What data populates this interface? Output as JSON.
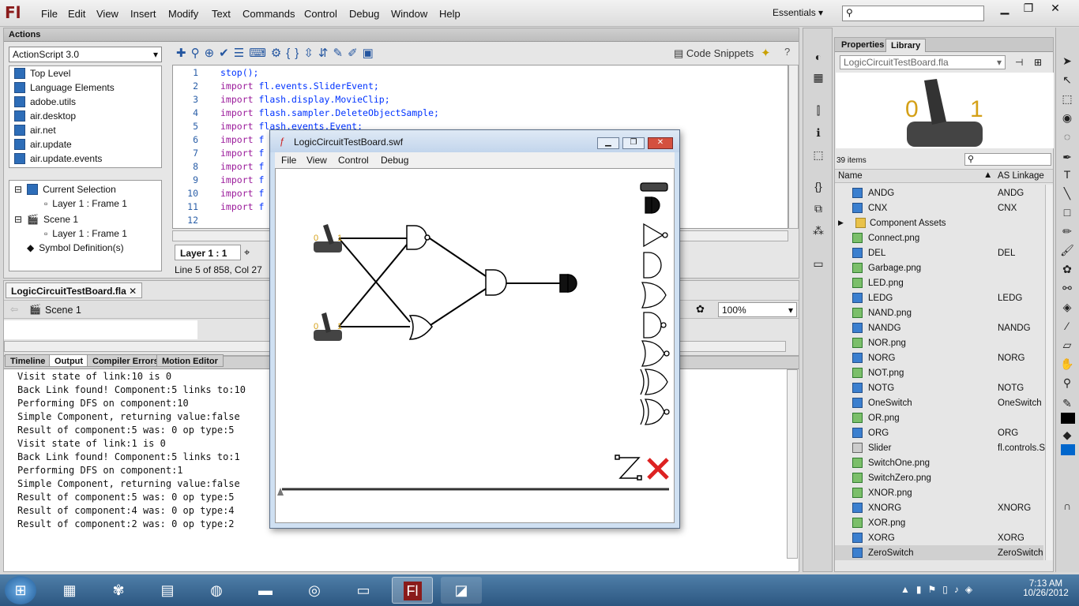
{
  "menu": {
    "items": [
      "File",
      "Edit",
      "View",
      "Insert",
      "Modify",
      "Text",
      "Commands",
      "Control",
      "Debug",
      "Window",
      "Help"
    ],
    "workspace": "Essentials",
    "logo": "Fl"
  },
  "actions": {
    "title": "Actions",
    "language": "ActionScript 3.0",
    "toolbox": [
      "Top Level",
      "Language Elements",
      "adobe.utils",
      "air.desktop",
      "air.net",
      "air.update",
      "air.update.events"
    ],
    "tree": {
      "current_selection": "Current Selection",
      "layer_frame": "Layer 1 : Frame 1",
      "scene": "Scene 1",
      "layer_frame2": "Layer 1 : Frame 1",
      "symbol_defs": "Symbol Definition(s)"
    },
    "code_snippets": "Code Snippets",
    "line_numbers": [
      "1",
      "2",
      "3",
      "4",
      "5",
      "6",
      "7",
      "8",
      "9",
      "10",
      "11",
      "12"
    ],
    "code_lines": [
      [
        "stop();",
        ""
      ],
      [
        "import ",
        "fl.events.SliderEvent;"
      ],
      [
        "import ",
        "flash.display.MovieClip;"
      ],
      [
        "import ",
        "flash.sampler.DeleteObjectSample;"
      ],
      [
        "import ",
        "flash.events.Event;"
      ],
      [
        "import ",
        "f"
      ],
      [
        "import ",
        "f"
      ],
      [
        "import ",
        "f"
      ],
      [
        "import ",
        "f"
      ],
      [
        "import ",
        "f"
      ],
      [
        "import ",
        "f"
      ],
      [
        "",
        ""
      ]
    ],
    "layer_tab": "Layer 1 : 1",
    "status": "Line 5 of 858, Col 27"
  },
  "document": {
    "tab": "LogicCircuitTestBoard.fla",
    "scene": "Scene 1",
    "zoom": "100%"
  },
  "output": {
    "tabs": [
      "Timeline",
      "Output",
      "Compiler Errors",
      "Motion Editor"
    ],
    "lines": [
      "Visit state of link:10 is 0",
      "Back Link found! Component:5 links to:10",
      "Performing DFS on component:10",
      "Simple Component, returning value:false",
      "Result of component:5 was: 0 op type:5",
      "Visit state of link:1 is 0",
      "Back Link found! Component:5 links to:1",
      "Performing DFS on component:1",
      "Simple Component, returning value:false",
      "Result of component:5 was: 0 op type:5",
      "Result of component:4 was: 0 op type:4",
      "Result of component:2 was: 0 op type:2"
    ]
  },
  "swf": {
    "title": "LogicCircuitTestBoard.swf",
    "menu": [
      "File",
      "View",
      "Control",
      "Debug"
    ],
    "switch_zero": "0",
    "switch_one": "1"
  },
  "library": {
    "tabs": [
      "Properties",
      "Library"
    ],
    "file": "LogicCircuitTestBoard.fla",
    "count": "39 items",
    "preview_zero": "0",
    "preview_one": "1",
    "col_name": "Name",
    "col_linkage": "AS Linkage",
    "items": [
      {
        "name": "ANDG",
        "linkage": "ANDG",
        "type": "sym"
      },
      {
        "name": "CNX",
        "linkage": "CNX",
        "type": "sym"
      },
      {
        "name": "Component Assets",
        "linkage": "",
        "type": "fld"
      },
      {
        "name": "Connect.png",
        "linkage": "",
        "type": "img"
      },
      {
        "name": "DEL",
        "linkage": "DEL",
        "type": "sym"
      },
      {
        "name": "Garbage.png",
        "linkage": "",
        "type": "img"
      },
      {
        "name": "LED.png",
        "linkage": "",
        "type": "img"
      },
      {
        "name": "LEDG",
        "linkage": "LEDG",
        "type": "sym"
      },
      {
        "name": "NAND.png",
        "linkage": "",
        "type": "img"
      },
      {
        "name": "NANDG",
        "linkage": "NANDG",
        "type": "sym"
      },
      {
        "name": "NOR.png",
        "linkage": "",
        "type": "img"
      },
      {
        "name": "NORG",
        "linkage": "NORG",
        "type": "sym"
      },
      {
        "name": "NOT.png",
        "linkage": "",
        "type": "img"
      },
      {
        "name": "NOTG",
        "linkage": "NOTG",
        "type": "sym"
      },
      {
        "name": "OneSwitch",
        "linkage": "OneSwitch",
        "type": "sym"
      },
      {
        "name": "OR.png",
        "linkage": "",
        "type": "img"
      },
      {
        "name": "ORG",
        "linkage": "ORG",
        "type": "sym"
      },
      {
        "name": "Slider",
        "linkage": "fl.controls.S",
        "type": "cmp"
      },
      {
        "name": "SwitchOne.png",
        "linkage": "",
        "type": "img"
      },
      {
        "name": "SwitchZero.png",
        "linkage": "",
        "type": "img"
      },
      {
        "name": "XNOR.png",
        "linkage": "",
        "type": "img"
      },
      {
        "name": "XNORG",
        "linkage": "XNORG",
        "type": "sym"
      },
      {
        "name": "XOR.png",
        "linkage": "",
        "type": "img"
      },
      {
        "name": "XORG",
        "linkage": "XORG",
        "type": "sym"
      },
      {
        "name": "ZeroSwitch",
        "linkage": "ZeroSwitch",
        "type": "sym"
      }
    ]
  },
  "taskbar": {
    "time": "7:13 AM",
    "date": "10/26/2012"
  }
}
